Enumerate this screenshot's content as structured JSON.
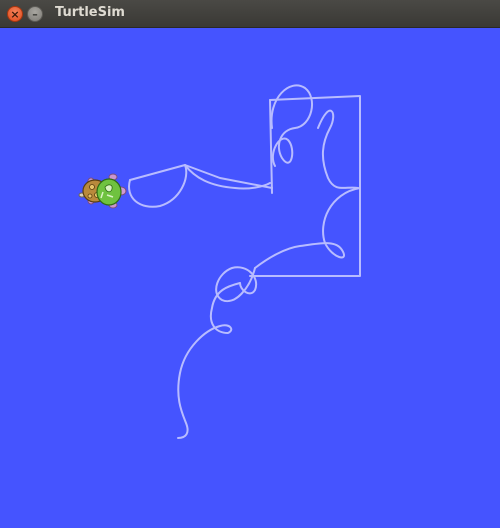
{
  "window": {
    "title": "TurtleSim",
    "close_icon": "close-icon",
    "minimize_icon": "minimize-icon"
  },
  "canvas": {
    "background_color": "#4554ff",
    "pen_color": "#b3b8ff",
    "turtle_icon": "turtle-icon"
  }
}
